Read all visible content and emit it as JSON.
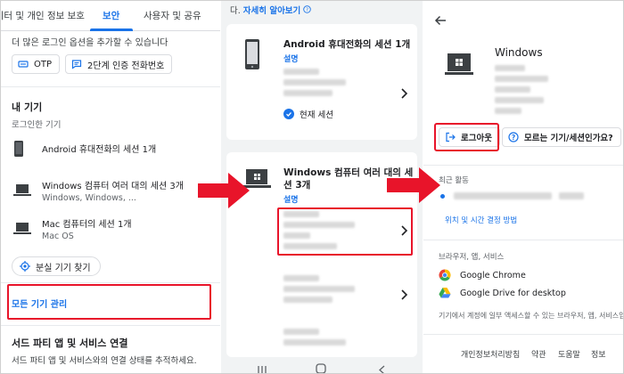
{
  "panel1": {
    "tabs": [
      "데이터 및 개인 정보 보호",
      "보안",
      "사용자 및 공유"
    ],
    "active_tab": "보안",
    "intro": "더 많은 로그인 옵션을 추가할 수 있습니다",
    "chips": {
      "otp": "OTP",
      "two_step": "2단계 인증 전화번호"
    },
    "my_devices_title": "내 기기",
    "signed_in_devices": "로그인한 기기",
    "devices": [
      {
        "name": "Android 휴대전화의 세션 1개",
        "sub": ""
      },
      {
        "name": "Windows 컴퓨터 여러 대의 세션 3개",
        "sub": "Windows, Windows, ..."
      },
      {
        "name": "Mac 컴퓨터의 세션 1개",
        "sub": "Mac OS"
      }
    ],
    "find_device": "분실 기기 찾기",
    "manage_all": "모든 기기 관리",
    "third_party_title": "서드 파티 앱 및 서비스 연결",
    "third_party_sub": "서드 파티 앱 및 서비스와의 연결 상태를 추적하세요."
  },
  "panel2": {
    "top_prefix": "다.",
    "top_link": "자세히 알아보기",
    "android": {
      "title": "Android 휴대전화의 세션 1개",
      "explain": "설명",
      "current": "현재 세션"
    },
    "windows": {
      "title": "Windows 컴퓨터 여러 대의 세션 3개",
      "explain": "설명"
    }
  },
  "panel3": {
    "title": "Windows",
    "logout": "로그아웃",
    "unknown": "모르는 기기/세션인가요?",
    "recent": "최근 활동",
    "location_info": "위치 및 시간 결정 방법",
    "browsers_head": "브라우저, 앱, 서비스",
    "services": [
      "Google Chrome",
      "Google Drive for desktop"
    ],
    "note": "기기에서 계정에 일부 액세스할 수 있는 브라우저, 앱, 서비스입니다",
    "footer": [
      "개인정보처리방침",
      "약관",
      "도움말",
      "정보"
    ]
  },
  "colors": {
    "accent": "#1a73e8",
    "highlight": "#e8142a",
    "arrow": "#e8142a"
  }
}
